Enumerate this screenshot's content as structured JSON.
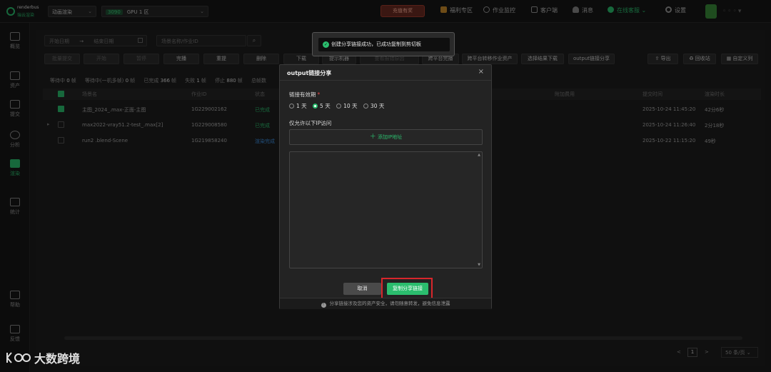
{
  "brand": {
    "name_en": "renderbus",
    "name_cn": "瑞云渲染"
  },
  "top": {
    "mode_select": "动画渲染",
    "gpu_badge": "3090",
    "gpu_select": "GPU 1 区",
    "recharge": "充值有奖",
    "nav": [
      "福利专区",
      "作业监控",
      "客户端",
      "消息",
      "在线客服",
      "设置"
    ]
  },
  "sidebar": [
    {
      "label": "概览",
      "icon": "overview-icon"
    },
    {
      "label": "资产",
      "icon": "assets-icon"
    },
    {
      "label": "提交",
      "icon": "submit-icon"
    },
    {
      "label": "分析",
      "icon": "analyze-icon"
    },
    {
      "label": "渲染",
      "icon": "render-icon",
      "active": true
    },
    {
      "label": "统计",
      "icon": "stats-icon"
    },
    {
      "label": "帮助",
      "icon": "help-icon"
    },
    {
      "label": "反馈",
      "icon": "feedback-icon"
    }
  ],
  "filters": {
    "start_date": "开始日期",
    "arrow": "→",
    "end_date": "结束日期",
    "search_placeholder": "场景名称/作业ID"
  },
  "toolbar": [
    "批量提交",
    "开始",
    "暂停",
    "完播",
    "重提",
    "删除",
    "下载",
    "提示机器",
    "查看报错原因",
    "跨平台完播",
    "跨平台转移作业资产",
    "选择结果下载",
    "output链接分享"
  ],
  "toolbar_right": [
    "导出",
    "回收站",
    "自定义列"
  ],
  "status": [
    {
      "label": "等待中",
      "value": "0",
      "unit": "帧"
    },
    {
      "label": "等待中(一机多帧)",
      "value": "0",
      "unit": "帧"
    },
    {
      "label": "已完成",
      "value": "366",
      "unit": "帧"
    },
    {
      "label": "失败",
      "value": "1",
      "unit": "帧"
    },
    {
      "label": "停止",
      "value": "880",
      "unit": "帧"
    },
    {
      "label": "总帧数",
      "value": "",
      "unit": ""
    }
  ],
  "table": {
    "headers": [
      "场景名",
      "作业ID",
      "状态",
      "附加费用",
      "提交时间",
      "渲染时长"
    ],
    "rows": [
      {
        "checked": true,
        "scene": "主图_2024_.max-正面-主图",
        "id": "1G229002162",
        "status": "已完成",
        "time": "2025-10-24 11:45:20",
        "duration": "42分6秒"
      },
      {
        "checked": false,
        "scene": "max2022-vray51.2-test_.max[2]",
        "id": "1G229008580",
        "status": "已完成",
        "time": "2025-10-24 11:26:40",
        "duration": "2分18秒"
      },
      {
        "checked": false,
        "scene": "run2 .blend-Scene",
        "id": "1G219858240",
        "status": "渲染完成",
        "time": "2025-10-22 11:15:20",
        "duration": "49秒"
      }
    ]
  },
  "pager": {
    "current": "1",
    "size": "50 条/页"
  },
  "toast": {
    "message": "创建分享链接成功，已成功复制到剪切板"
  },
  "modal": {
    "title": "output链接分享",
    "close": "×",
    "validity_label": "链接有效期",
    "required_mark": "*",
    "options": [
      "1 天",
      "5 天",
      "10 天",
      "30 天"
    ],
    "selected_option": "5 天",
    "ip_label": "仅允许以下IP访问",
    "add_ip": "添加IP地址",
    "ip_list_value": "",
    "cancel": "取消",
    "copy": "复制分享链接",
    "footer_note": "分享链接涉及您的资产安全，请勿随意转发，避免信息泄露"
  },
  "watermark": "大数跨境"
}
